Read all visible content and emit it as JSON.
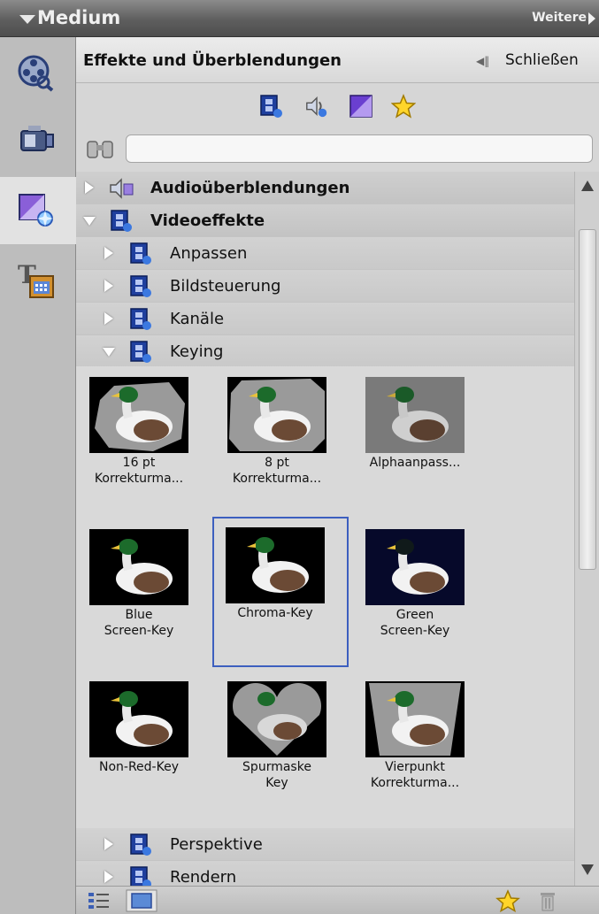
{
  "window": {
    "title": "Medium",
    "more_label": "Weitere"
  },
  "sidebar": {
    "items": [
      {
        "name": "media-icon"
      },
      {
        "name": "camera-icon"
      },
      {
        "name": "effects-icon"
      },
      {
        "name": "titles-icon"
      }
    ]
  },
  "panel": {
    "title": "Effekte und Überblendungen",
    "close_label": "Schließen",
    "filter_icons": [
      "video-effects-filter-icon",
      "audio-effects-filter-icon",
      "transitions-filter-icon",
      "favorites-filter-icon"
    ]
  },
  "search": {
    "value": "",
    "placeholder": ""
  },
  "tree": {
    "audio_transitions": "Audioüberblendungen",
    "video_effects": "Videoeffekte",
    "subcategories": {
      "anpassen": "Anpassen",
      "bildsteuerung": "Bildsteuerung",
      "kanaele": "Kanäle",
      "keying": "Keying",
      "perspektive": "Perspektive",
      "rendern": "Rendern"
    }
  },
  "keying_effects": [
    {
      "label": "16 pt\nKorrekturma...",
      "selected": false
    },
    {
      "label": "8 pt\nKorrekturma...",
      "selected": false
    },
    {
      "label": "Alphaanpass...",
      "selected": false
    },
    {
      "label": "Blue\nScreen-Key",
      "selected": false
    },
    {
      "label": "Chroma-Key",
      "selected": true
    },
    {
      "label": "Green\nScreen-Key",
      "selected": false
    },
    {
      "label": "Non-Red-Key",
      "selected": false
    },
    {
      "label": "Spurmaske\nKey",
      "selected": false
    },
    {
      "label": "Vierpunkt\nKorrekturma...",
      "selected": false
    }
  ],
  "footer": {
    "icons": [
      "list-view-icon",
      "thumbnail-view-icon",
      "favorites-icon",
      "trash-icon"
    ]
  },
  "colors": {
    "selection_border": "#3d5fbf",
    "accent_blue": "#1a3a8a"
  }
}
